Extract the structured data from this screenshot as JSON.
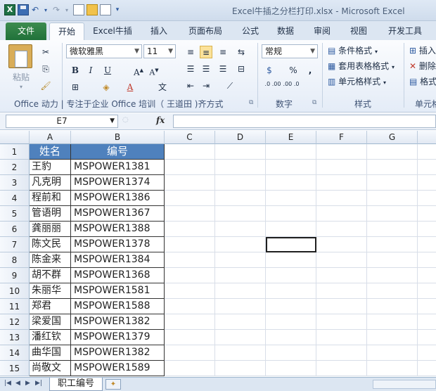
{
  "window": {
    "title": "Excel牛插之分栏打印.xlsx  -  Microsoft Excel",
    "app_icon": "excel-logo-icon"
  },
  "ribbon": {
    "tabs": [
      "文件",
      "开始",
      "Excel牛插",
      "插入",
      "页面布局",
      "公式",
      "数据",
      "审阅",
      "视图",
      "开发工具"
    ],
    "active_tab": "开始",
    "font_name": "微软雅黑",
    "font_size": "11",
    "number_format": "常规",
    "paste_label": "粘贴",
    "group_clipboard_font_label": "Office 动力 | 专注于企业 Office 培训（ 王道田 )齐方式",
    "group_number_label": "数字",
    "group_style_label": "样式",
    "group_cells_label": "单元格",
    "style_items": [
      "条件格式",
      "套用表格格式",
      "单元格样式"
    ],
    "cells_items": [
      "插入",
      "删除",
      "格式"
    ],
    "percent": "%",
    "comma": ",",
    "inc_decimal": ".0 .00",
    "dec_decimal": ".00 .0"
  },
  "formula_bar": {
    "name_box": "E7",
    "fx": "fx",
    "formula": ""
  },
  "sheet": {
    "columns": [
      "A",
      "B",
      "C",
      "D",
      "E",
      "F",
      "G"
    ],
    "rows": [
      "1",
      "2",
      "3",
      "4",
      "5",
      "6",
      "7",
      "8",
      "9",
      "10",
      "11",
      "12",
      "13",
      "14",
      "15"
    ],
    "header": [
      "姓名",
      "编号"
    ],
    "records": [
      [
        "王豹",
        "MSPOWER1381"
      ],
      [
        "凡克明",
        "MSPOWER1374"
      ],
      [
        "程前和",
        "MSPOWER1386"
      ],
      [
        "管语明",
        "MSPOWER1367"
      ],
      [
        "龚丽丽",
        "MSPOWER1388"
      ],
      [
        "陈文民",
        "MSPOWER1378"
      ],
      [
        "陈金来",
        "MSPOWER1384"
      ],
      [
        "胡不群",
        "MSPOWER1368"
      ],
      [
        "朱丽华",
        "MSPOWER1581"
      ],
      [
        "郑君",
        "MSPOWER1588"
      ],
      [
        "梁爱国",
        "MSPOWER1382"
      ],
      [
        "潘红钦",
        "MSPOWER1379"
      ],
      [
        "曲华国",
        "MSPOWER1382"
      ],
      [
        "尚敬文",
        "MSPOWER1589"
      ]
    ],
    "header_color": "#4f81bd"
  },
  "sheet_tabs": {
    "active": "职工编号"
  }
}
